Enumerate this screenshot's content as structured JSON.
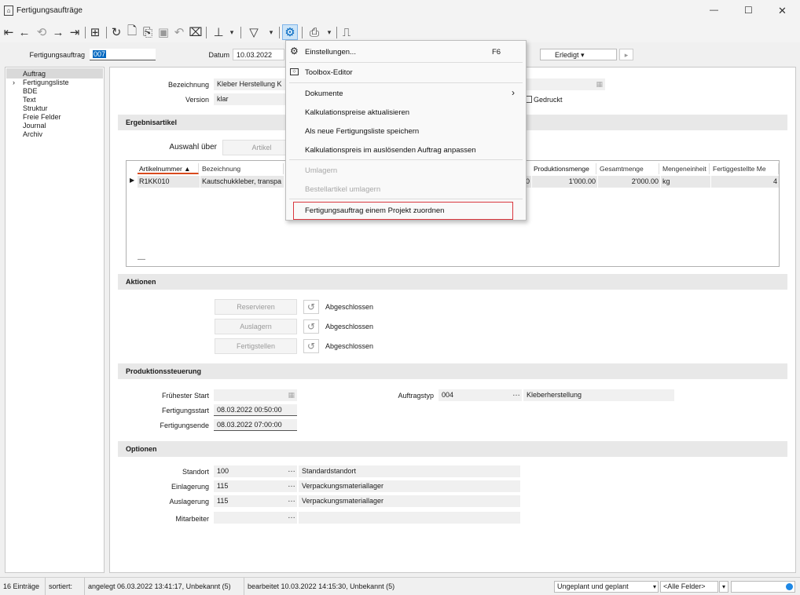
{
  "window": {
    "title": "Fertigungsaufträge",
    "minimize": "—",
    "maximize": "☐",
    "close": "✕"
  },
  "header": {
    "auftrag_label": "Fertigungsauftrag",
    "auftrag_value": "007",
    "datum_label": "Datum",
    "datum_value": "10.03.2022",
    "status_value": "Erledigt ▾"
  },
  "nav": {
    "items": [
      "Auftrag",
      "Fertigungsliste",
      "BDE",
      "Text",
      "Struktur",
      "Freie Felder",
      "Journal",
      "Archiv"
    ]
  },
  "form": {
    "bezeichnung_label": "Bezeichnung",
    "bezeichnung_value": "Kleber Herstellung K",
    "version_label": "Version",
    "version_value": "klar",
    "gedruckt_label": "Gedruckt"
  },
  "ergebnis": {
    "title": "Ergebnisartikel",
    "auswahl_label": "Auswahl über",
    "auswahl_button": "Artikel",
    "columns": [
      "Artikelnummer ▲",
      "Bezeichnung",
      "Produktionsmenge",
      "Gesamtmenge",
      "Mengeneinheit",
      "Fertiggestellte Me"
    ],
    "row": {
      "artikelnummer": "R1KK010",
      "bezeichnung": "Kautschukkleber, transpa",
      "stray": "0",
      "produktionsmenge": "1'000.00",
      "gesamtmenge": "2'000.00",
      "mengeneinheit": "kg",
      "fertig": "4"
    },
    "marker": "▶",
    "new_row_dash": "—"
  },
  "aktionen": {
    "title": "Aktionen",
    "reservieren": "Reservieren",
    "auslagern": "Auslagern",
    "fertigstellen": "Fertigstellen",
    "status": "Abgeschlossen"
  },
  "produktion": {
    "title": "Produktionssteuerung",
    "fruehester_label": "Frühester Start",
    "fruehester_value": "",
    "fstart_label": "Fertigungsstart",
    "fstart_value": "08.03.2022 00:50:00",
    "fende_label": "Fertigungsende",
    "fende_value": "08.03.2022 07:00:00",
    "auftragstyp_label": "Auftragstyp",
    "auftragstyp_value": "004",
    "auftragstyp_desc": "Kleberherstellung"
  },
  "optionen": {
    "title": "Optionen",
    "rows": [
      {
        "label": "Standort",
        "value": "100",
        "desc": "Standardstandort"
      },
      {
        "label": "Einlagerung",
        "value": "115",
        "desc": "Verpackungsmateriallager"
      },
      {
        "label": "Auslagerung",
        "value": "115",
        "desc": "Verpackungsmateriallager"
      },
      {
        "label": "Mitarbeiter",
        "value": "",
        "desc": ""
      }
    ]
  },
  "menu": {
    "einstellungen": "Einstellungen...",
    "einstellungen_shortcut": "F6",
    "toolbox": "Toolbox-Editor",
    "dokumente": "Dokumente",
    "kalk_aktualisieren": "Kalkulationspreise aktualisieren",
    "als_liste": "Als neue Fertigungsliste speichern",
    "kalk_anpassen": "Kalkulationspreis im auslösenden Auftrag anpassen",
    "umlagern": "Umlagern",
    "bestell_umlagern": "Bestellartikel umlagern",
    "projekt_zuordnen": "Fertigungsauftrag einem Projekt zuordnen"
  },
  "status": {
    "eintraege": "16 Einträge",
    "sortiert": "sortiert:",
    "angelegt": "angelegt 06.03.2022 13:41:17, Unbekannt (5)",
    "bearbeitet": "bearbeitet 10.03.2022 14:15:30, Unbekannt (5)",
    "filter": "Ungeplant und geplant",
    "felder": "<Alle Felder>"
  },
  "colors": {
    "accent": "#0067c0",
    "highlight_box": "#d9363e"
  }
}
